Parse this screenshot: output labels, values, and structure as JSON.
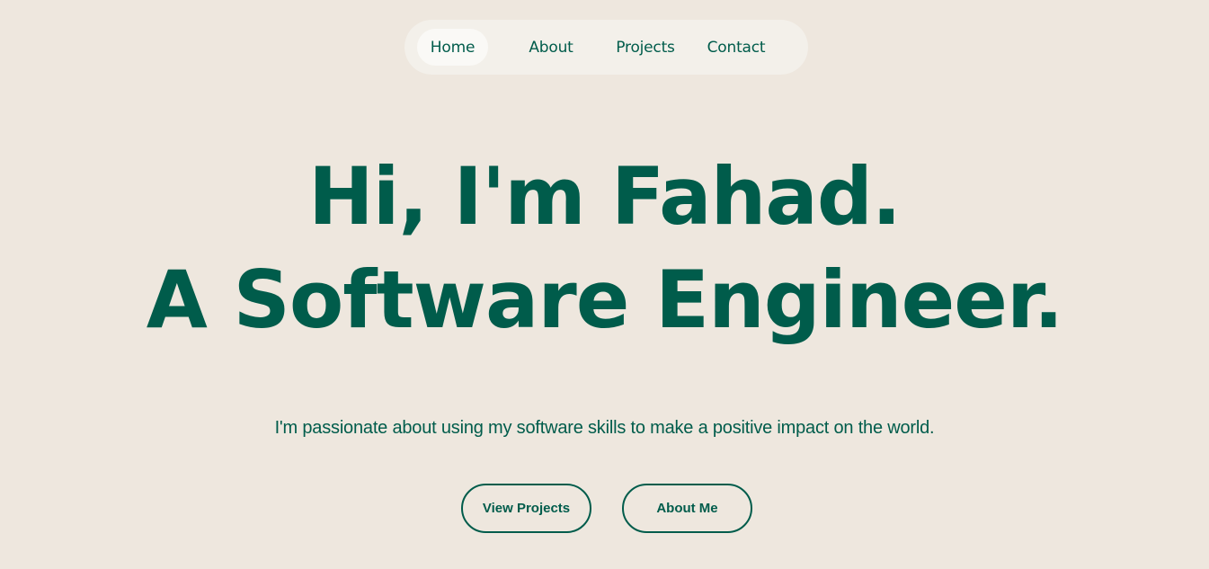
{
  "nav": {
    "items": [
      {
        "label": "Home",
        "active": true
      },
      {
        "label": "About",
        "active": false
      },
      {
        "label": "Projects",
        "active": false
      },
      {
        "label": "Contact",
        "active": false
      }
    ]
  },
  "hero": {
    "line1": "Hi, I'm Fahad.",
    "line2": "A Software Engineer."
  },
  "subtitle": "I'm passionate about using my software skills to make a positive impact on the world.",
  "buttons": {
    "view_projects": "View Projects",
    "about_me": "About Me"
  },
  "colors": {
    "background": "#EEE7DE",
    "nav_background": "#F3F0EA",
    "accent": "#005C4B"
  }
}
